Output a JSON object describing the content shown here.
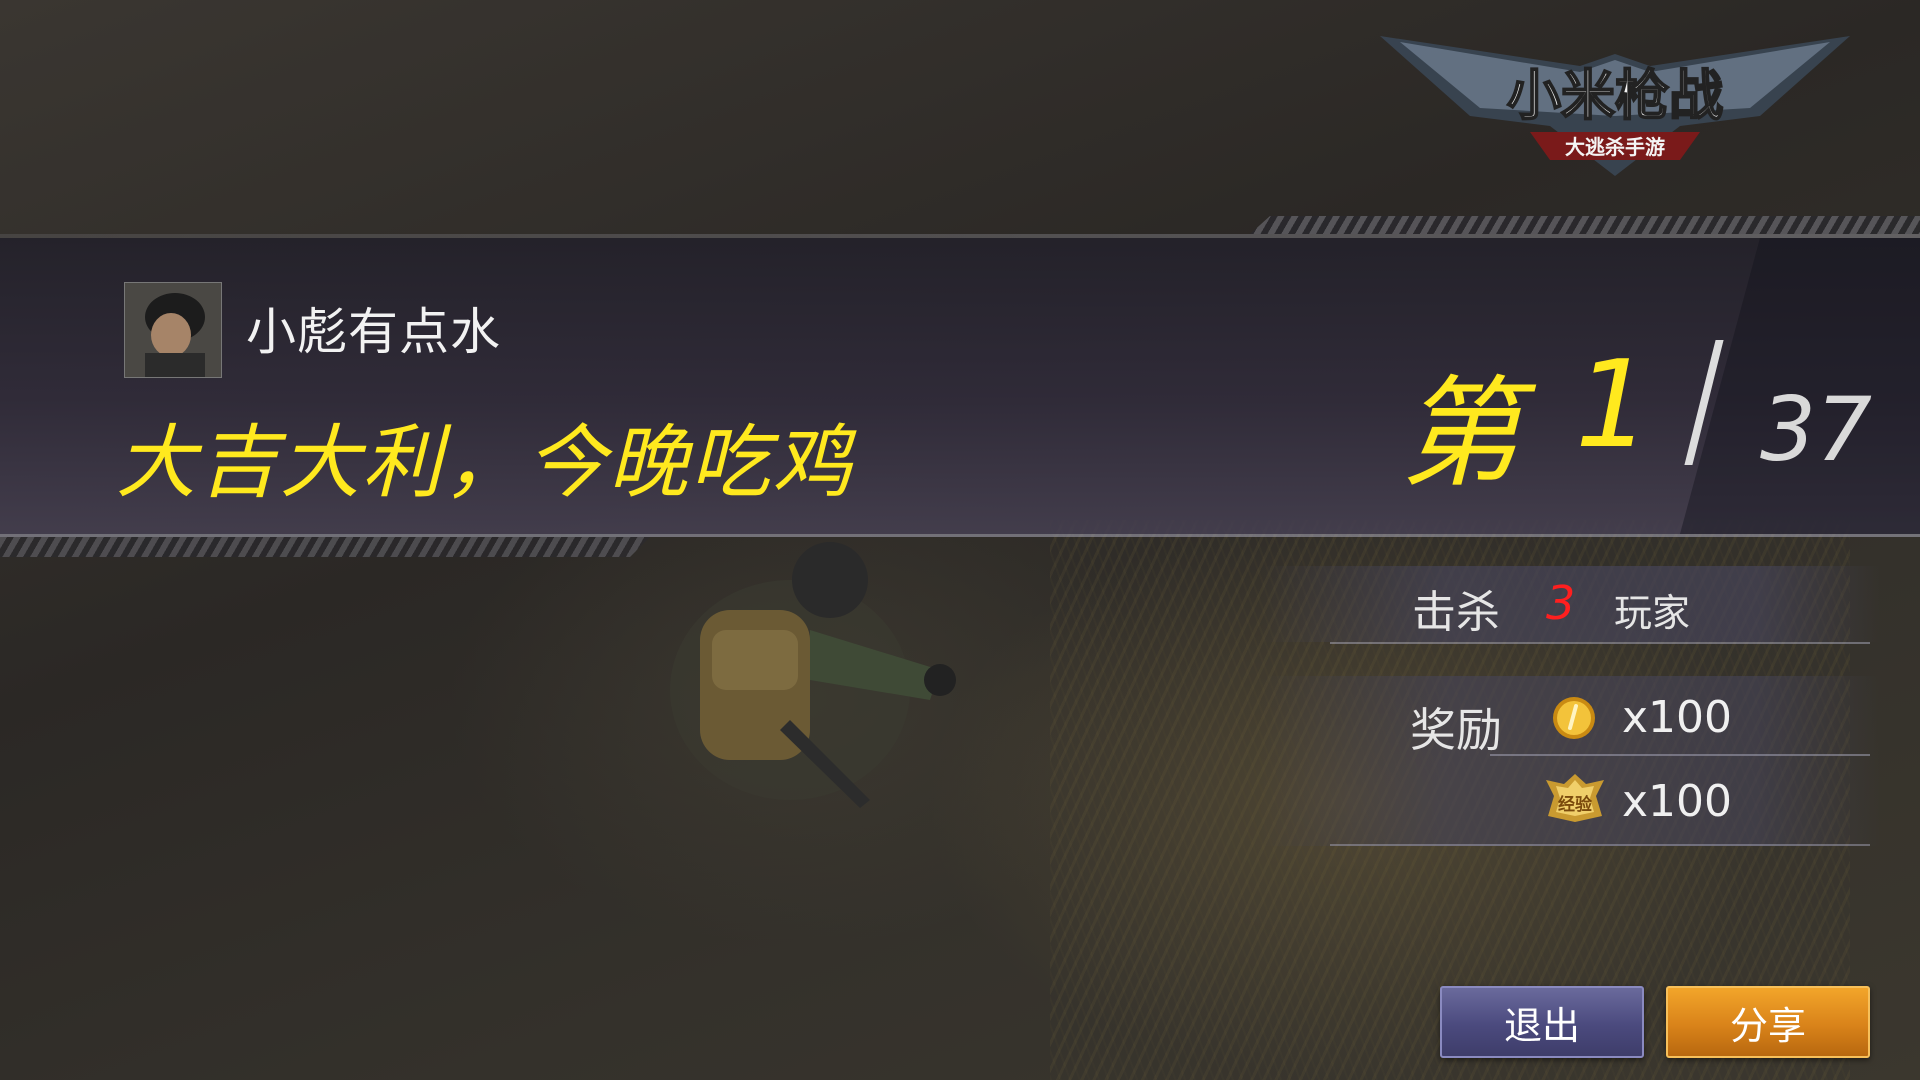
{
  "logo": {
    "title": "小米枪战",
    "subtitle": "大逃杀手游"
  },
  "player": {
    "name": "小彪有点水"
  },
  "result": {
    "message": "大吉大利，今晚吃鸡",
    "rank_prefix": "第",
    "rank": "1",
    "total": "37"
  },
  "stats": {
    "kill_label": "击杀",
    "kills": "3",
    "kill_unit": "玩家",
    "reward_label": "奖励",
    "coin_reward": "x100",
    "exp_reward": "x100",
    "exp_badge_text": "经验"
  },
  "buttons": {
    "exit": "退出",
    "share": "分享"
  },
  "colors": {
    "highlight": "#ffe91e",
    "kill_number": "#ff1f1f",
    "exit_button": "#4b4a7e",
    "share_button": "#d9831a"
  },
  "icons": {
    "coin": "gold-coin-icon",
    "exp": "experience-badge-icon"
  }
}
